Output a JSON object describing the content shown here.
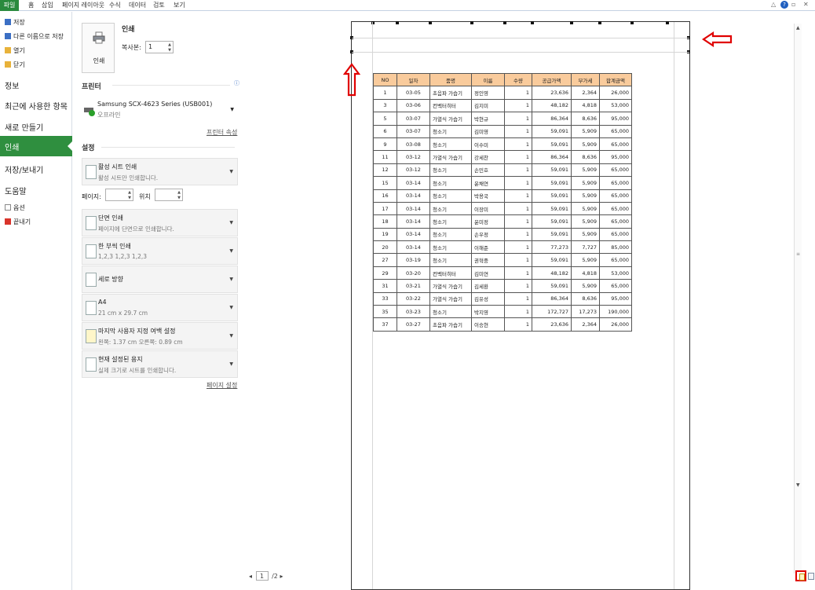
{
  "ribbon": {
    "tabs": [
      "파일",
      "홈",
      "삽입",
      "페이지 레이아웃",
      "수식",
      "데이터",
      "검토",
      "보기"
    ],
    "help_glyph": "?",
    "window_controls": [
      "△",
      "▫",
      "✕"
    ]
  },
  "nav": {
    "save": "저장",
    "save_as": "다른 이름으로 저장",
    "open": "열기",
    "close": "닫기",
    "info": "정보",
    "recent": "최근에 사용한 항목",
    "new": "새로 만들기",
    "print": "인쇄",
    "save_send": "저장/보내기",
    "help": "도움말",
    "options": "옵션",
    "exit": "끝내기"
  },
  "print_panel": {
    "print_title": "인쇄",
    "print_button": "인쇄",
    "copies_label": "복사본:",
    "copies_value": "1",
    "printer_heading": "프린터",
    "printer_name": "Samsung SCX-4623 Series (USB001)",
    "printer_status": "오프라인",
    "printer_properties": "프린터 속성",
    "settings_heading": "설정",
    "what_title": "활성 시트 인쇄",
    "what_sub": "활성 시트만 인쇄합니다.",
    "pages_label": "페이지:",
    "to_label": "위치",
    "pages_from": "",
    "pages_to": "",
    "sides_title": "단면 인쇄",
    "sides_sub": "페이지에 단면으로 인쇄합니다.",
    "collate_title": "한 부씩 인쇄",
    "collate_sub": "1,2,3    1,2,3    1,2,3",
    "orientation_title": "세로 방향",
    "paper_title": "A4",
    "paper_sub": "21 cm x 29.7 cm",
    "margins_title": "마지막 사용자 지정 여백 설정",
    "margins_sub": "왼쪽:  1.37 cm    오른쪽:  0.89 cm",
    "scaling_title": "현재 설정된 용지",
    "scaling_sub": "실제 크기로 시트를 인쇄합니다.",
    "page_setup": "페이지 설정"
  },
  "preview": {
    "headers": [
      "NO",
      "일자",
      "품명",
      "이름",
      "수량",
      "공급가액",
      "부가세",
      "합계금액"
    ],
    "rows": [
      [
        "1",
        "03-05",
        "초음파 가습기",
        "정인영",
        "1",
        "23,636",
        "2,364",
        "26,000"
      ],
      [
        "3",
        "03-06",
        "컨벡터히터",
        "김지미",
        "1",
        "48,182",
        "4,818",
        "53,000"
      ],
      [
        "5",
        "03-07",
        "가열식 가습기",
        "박현규",
        "1",
        "86,364",
        "8,636",
        "95,000"
      ],
      [
        "6",
        "03-07",
        "청소기",
        "김미영",
        "1",
        "59,091",
        "5,909",
        "65,000"
      ],
      [
        "9",
        "03-08",
        "청소기",
        "이수미",
        "1",
        "59,091",
        "5,909",
        "65,000"
      ],
      [
        "11",
        "03-12",
        "가열식 가습기",
        "강세찬",
        "1",
        "86,364",
        "8,636",
        "95,000"
      ],
      [
        "12",
        "03-12",
        "청소기",
        "손민호",
        "1",
        "59,091",
        "5,909",
        "65,000"
      ],
      [
        "15",
        "03-14",
        "청소기",
        "윤채연",
        "1",
        "59,091",
        "5,909",
        "65,000"
      ],
      [
        "16",
        "03-14",
        "청소기",
        "박용국",
        "1",
        "59,091",
        "5,909",
        "65,000"
      ],
      [
        "17",
        "03-14",
        "청소기",
        "이장미",
        "1",
        "59,091",
        "5,909",
        "65,000"
      ],
      [
        "18",
        "03-14",
        "청소기",
        "윤미정",
        "1",
        "59,091",
        "5,909",
        "65,000"
      ],
      [
        "19",
        "03-14",
        "청소기",
        "손우정",
        "1",
        "59,091",
        "5,909",
        "65,000"
      ],
      [
        "20",
        "03-14",
        "청소기",
        "이해준",
        "1",
        "77,273",
        "7,727",
        "85,000"
      ],
      [
        "27",
        "03-19",
        "청소기",
        "권혁중",
        "1",
        "59,091",
        "5,909",
        "65,000"
      ],
      [
        "29",
        "03-20",
        "컨벡터히터",
        "김미연",
        "1",
        "48,182",
        "4,818",
        "53,000"
      ],
      [
        "31",
        "03-21",
        "가열식 가습기",
        "김세환",
        "1",
        "59,091",
        "5,909",
        "65,000"
      ],
      [
        "33",
        "03-22",
        "가열식 가습기",
        "김유성",
        "1",
        "86,364",
        "8,636",
        "95,000"
      ],
      [
        "35",
        "03-23",
        "청소기",
        "박지영",
        "1",
        "172,727",
        "17,273",
        "190,000"
      ],
      [
        "37",
        "03-27",
        "초음파 가습기",
        "이승현",
        "1",
        "23,636",
        "2,364",
        "26,000"
      ]
    ],
    "current_page": "1",
    "total_pages": "/2",
    "prev_glyph": "◂",
    "next_glyph": "▸"
  },
  "icons": {
    "annotation_arrows": "red-outline-arrow",
    "highlight_color": "#e00000",
    "header_fill": "#f9cb9c",
    "accent": "#2f8f3f"
  }
}
